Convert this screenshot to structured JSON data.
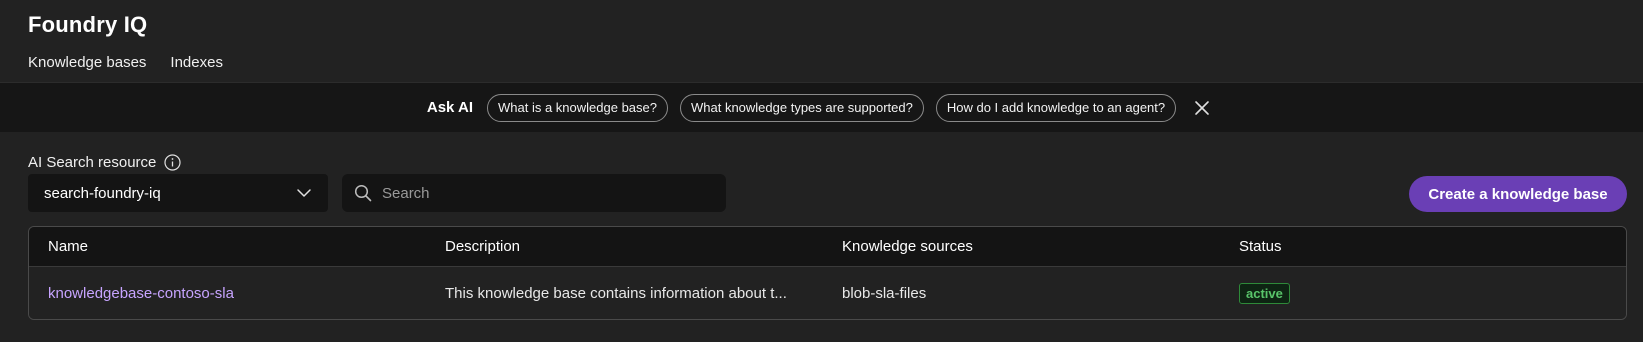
{
  "header": {
    "title": "Foundry IQ",
    "tabs": [
      {
        "label": "Knowledge bases"
      },
      {
        "label": "Indexes"
      }
    ]
  },
  "ask_ai": {
    "label": "Ask AI",
    "suggestions": [
      {
        "label": "What is a knowledge base?"
      },
      {
        "label": "What knowledge types are supported?"
      },
      {
        "label": "How do I add knowledge to an agent?"
      }
    ],
    "close_icon": "close-icon"
  },
  "resource": {
    "label": "AI Search resource",
    "info_icon": "info-icon",
    "selected": "search-foundry-iq"
  },
  "search": {
    "placeholder": "Search"
  },
  "create_button": {
    "label": "Create a knowledge base",
    "color": "#6a3fb5"
  },
  "table": {
    "columns": [
      "Name",
      "Description",
      "Knowledge sources",
      "Status"
    ],
    "rows": [
      {
        "name": "knowledgebase-contoso-sla",
        "description": "This knowledge base contains information about t...",
        "sources": "blob-sla-files",
        "status": "active"
      }
    ]
  },
  "colors": {
    "accent": "#6a3fb5",
    "link": "#c7a4ff",
    "status_active": "#59c46a",
    "background": "#222222"
  }
}
